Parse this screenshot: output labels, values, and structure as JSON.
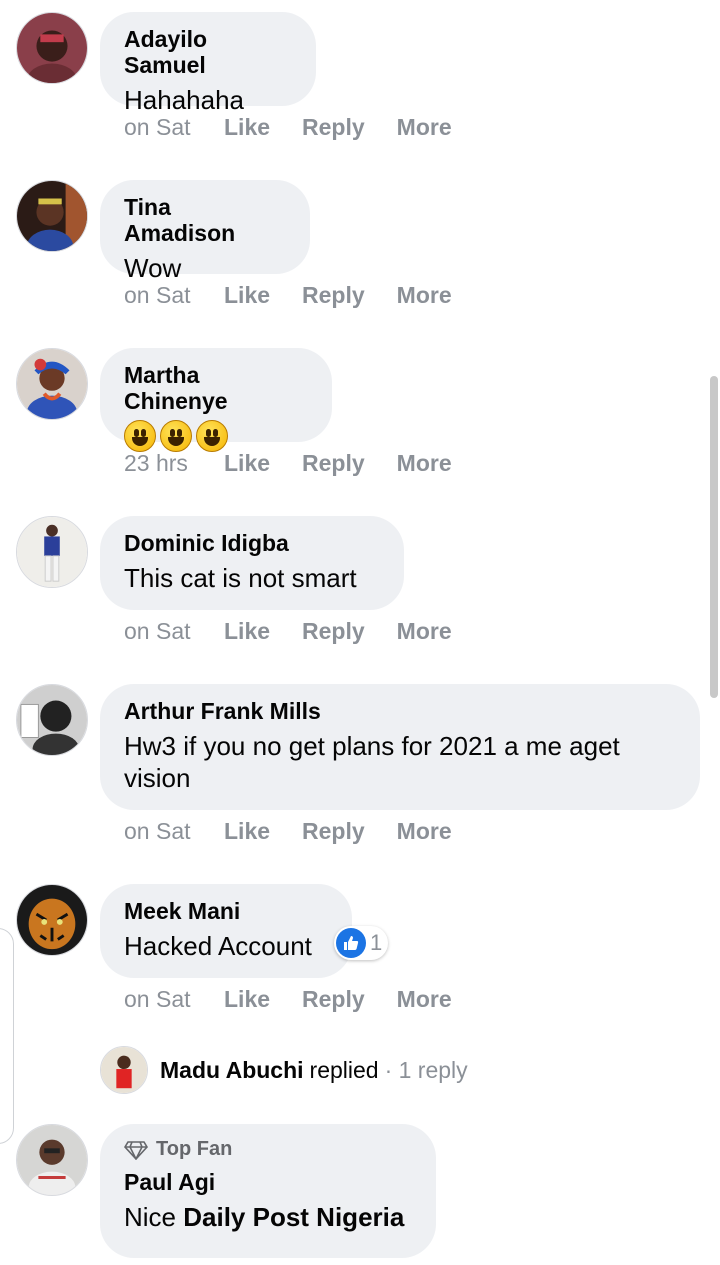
{
  "comments": [
    {
      "name": "Adayilo Samuel",
      "text": "Hahahaha",
      "time": "on Sat",
      "like": "Like",
      "reply": "Reply",
      "more": "More"
    },
    {
      "name": "Tina Amadison",
      "text": "Wow",
      "time": "on Sat",
      "like": "Like",
      "reply": "Reply",
      "more": "More"
    },
    {
      "name": "Martha Chinenye",
      "text": "",
      "time": "23 hrs",
      "like": "Like",
      "reply": "Reply",
      "more": "More"
    },
    {
      "name": "Dominic Idigba",
      "text": "This cat is not smart",
      "time": "on Sat",
      "like": "Like",
      "reply": "Reply",
      "more": "More"
    },
    {
      "name": "Arthur Frank Mills",
      "text_line1": "Hw3 if you no get plans for 2021 a me aget",
      "text_line2": "vision",
      "time": "on Sat",
      "like": "Like",
      "reply": "Reply",
      "more": "More"
    },
    {
      "name": "Meek Mani",
      "text": "Hacked Account",
      "time": "on Sat",
      "like": "Like",
      "reply": "Reply",
      "more": "More",
      "reaction_count": "1"
    },
    {
      "badge": "Top Fan",
      "name": "Paul Agi",
      "text_prefix": "Nice",
      "text_bold": "Daily Post Nigeria"
    }
  ],
  "reply_summary": {
    "name": "Madu Abuchi",
    "word": "replied",
    "count": "· 1 reply"
  },
  "icons": {
    "emoji": "grinning-face",
    "reaction": "thumbs-up-icon",
    "badge": "diamond-icon"
  },
  "colors": {
    "bubble": "#eef0f3",
    "meta": "#8b9097",
    "like_blue": "#1b74e4"
  }
}
